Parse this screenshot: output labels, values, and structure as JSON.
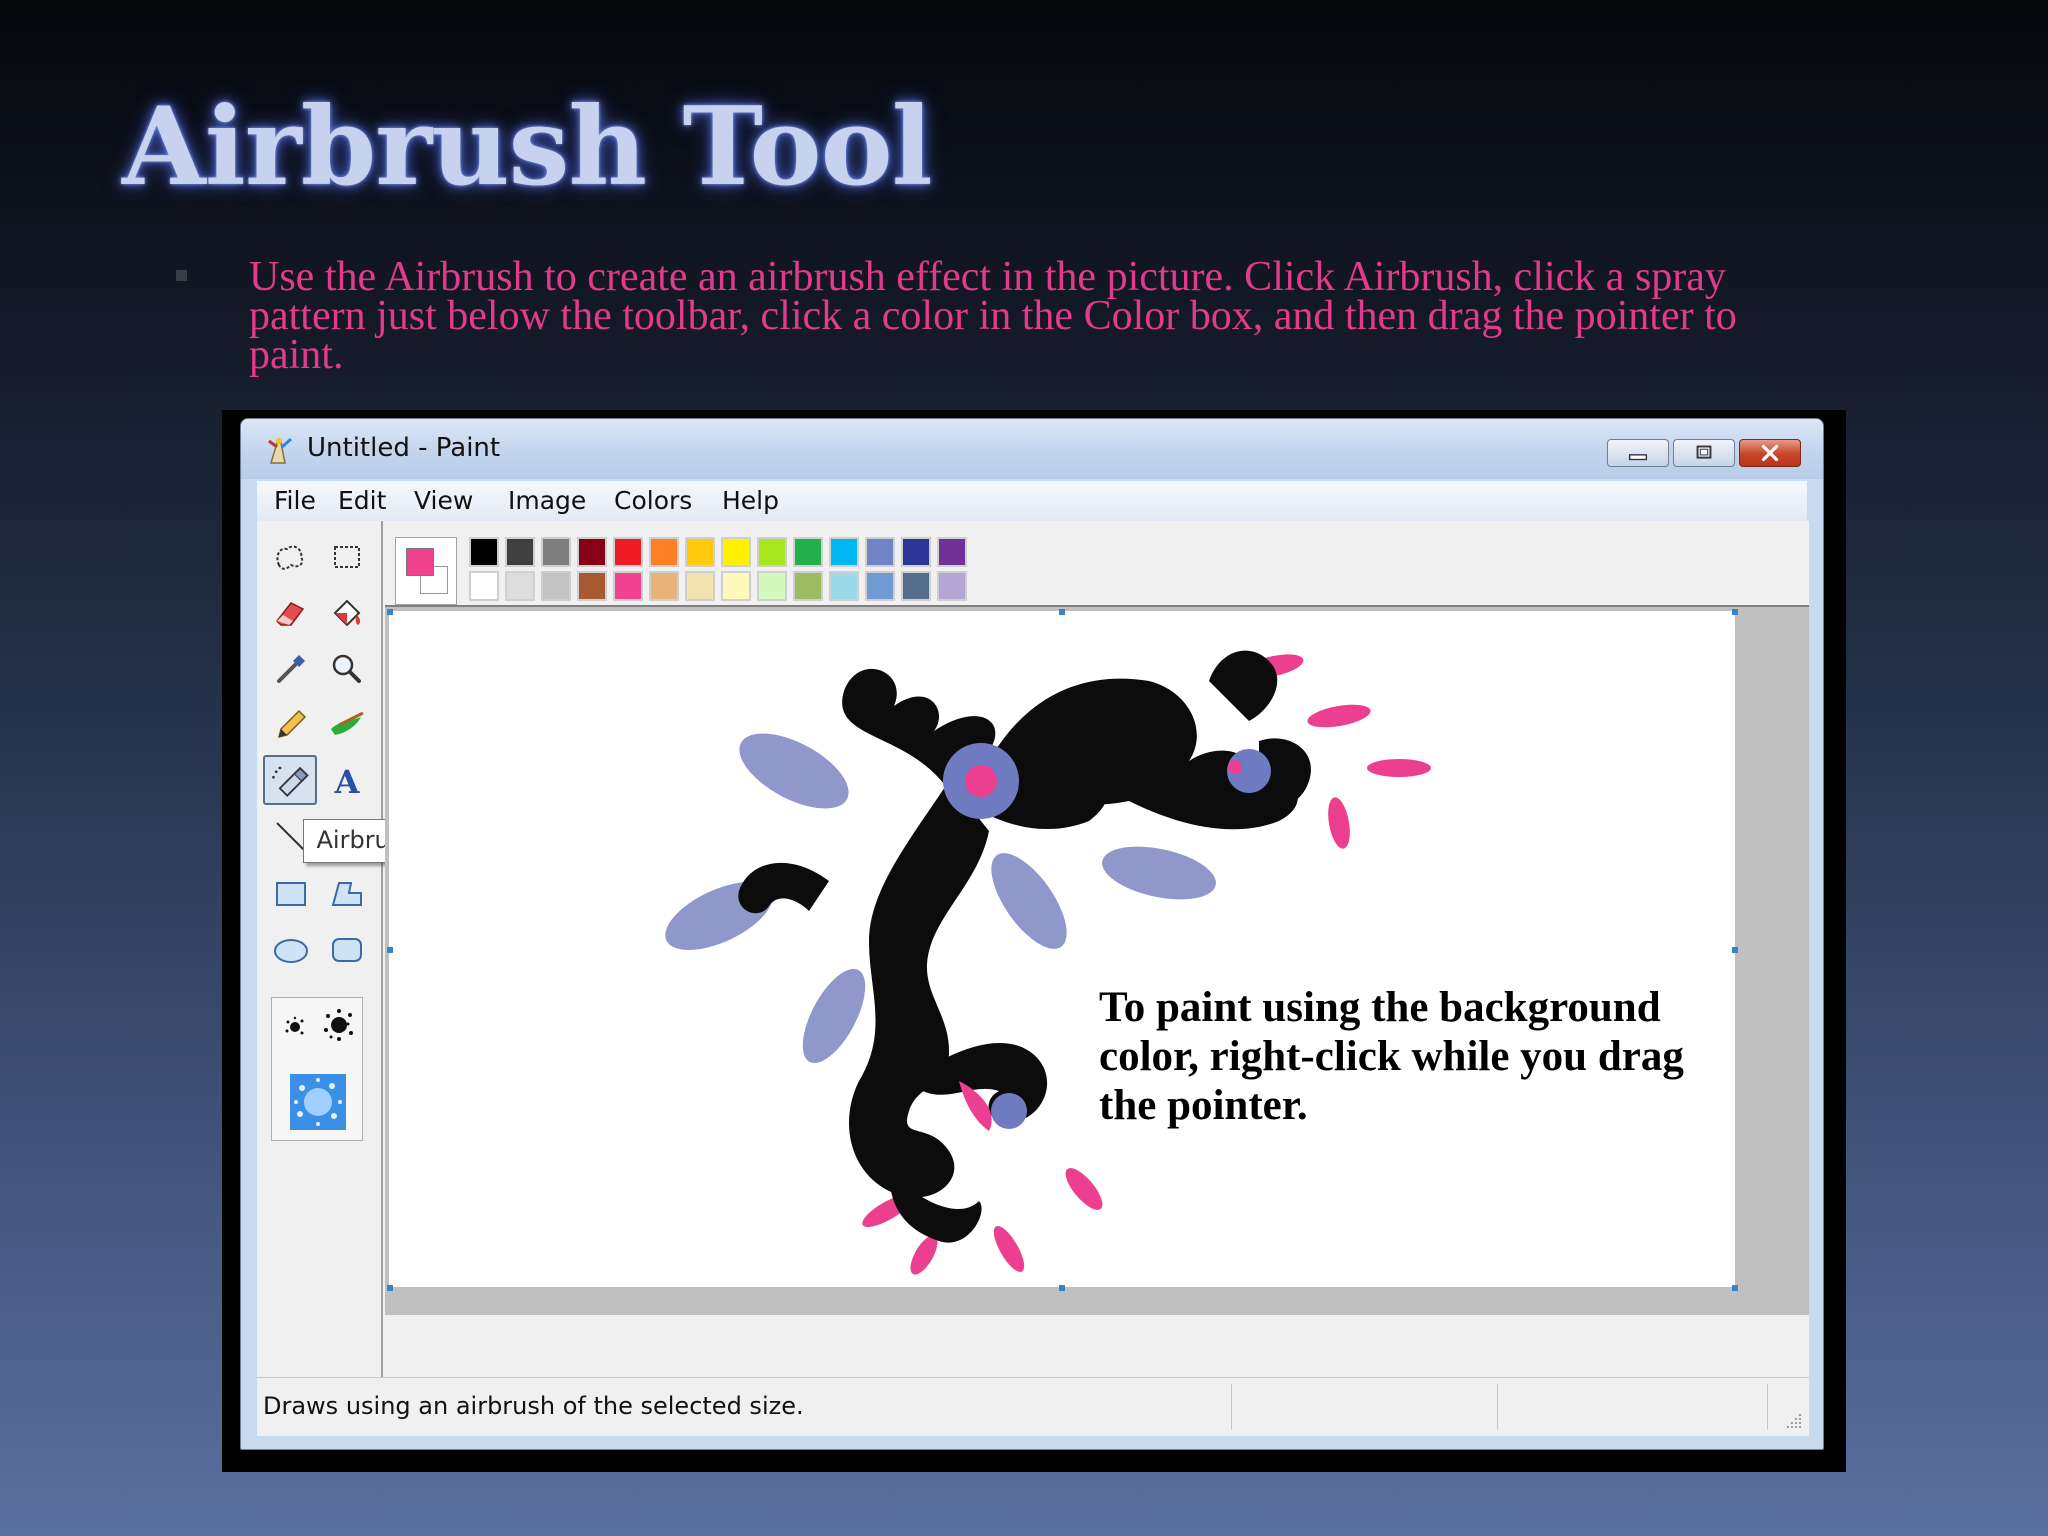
{
  "slide": {
    "title": "Airbrush Tool",
    "bullet": "Use the Airbrush to create an airbrush effect in the picture. Click Airbrush, click a spray pattern just below the toolbar, click a color in the Color box, and then drag the pointer to paint."
  },
  "window": {
    "title": "Untitled - Paint",
    "icons": {
      "app": "paint-app-icon",
      "minimize": "minimize-icon",
      "maximize": "maximize-icon",
      "close": "close-icon"
    }
  },
  "menu": [
    "File",
    "Edit",
    "View",
    "Image",
    "Colors",
    "Help"
  ],
  "tools": [
    {
      "name": "free-form-select-icon"
    },
    {
      "name": "select-icon"
    },
    {
      "name": "eraser-icon"
    },
    {
      "name": "fill-with-color-icon"
    },
    {
      "name": "pick-color-icon"
    },
    {
      "name": "magnifier-icon"
    },
    {
      "name": "pencil-icon"
    },
    {
      "name": "brush-icon"
    },
    {
      "name": "airbrush-icon",
      "selected": true
    },
    {
      "name": "text-icon"
    },
    {
      "name": "line-icon"
    },
    {
      "name": "curve-icon"
    },
    {
      "name": "rectangle-icon"
    },
    {
      "name": "polygon-icon"
    },
    {
      "name": "ellipse-icon"
    },
    {
      "name": "rounded-rectangle-icon"
    }
  ],
  "tooltip": "Airbrush",
  "colors": {
    "foreground": "#f0438f",
    "background": "#ffffff",
    "palette_top": [
      "#000000",
      "#404040",
      "#7f7f7f",
      "#880015",
      "#ed1c24",
      "#ff7f27",
      "#ffc90e",
      "#fff200",
      "#a8e61d",
      "#22b14c",
      "#00b7ef",
      "#7083c4",
      "#2f3699",
      "#6f3198"
    ],
    "palette_bottom": [
      "#ffffff",
      "#dcdcdc",
      "#c3c3c3",
      "#a55a32",
      "#f0438f",
      "#e7b37a",
      "#efe4b0",
      "#fff9bd",
      "#d3f9bc",
      "#9dbb61",
      "#99d9ea",
      "#709ad1",
      "#546d8e",
      "#b5a5d5"
    ]
  },
  "canvas": {
    "text": "To paint using the background color, right-click while you drag the pointer."
  },
  "status": {
    "text": "Draws using an airbrush of the selected size."
  }
}
